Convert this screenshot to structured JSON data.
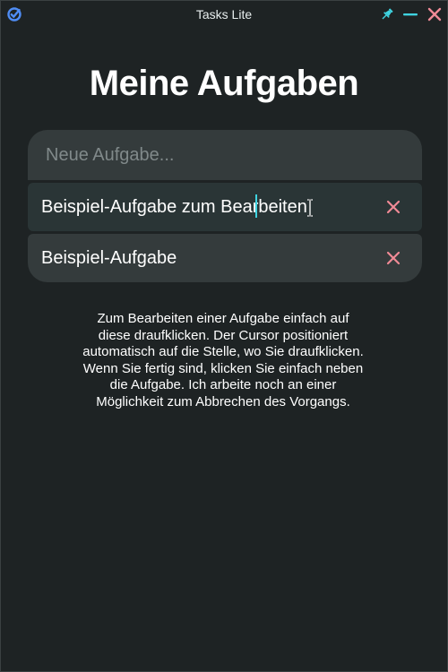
{
  "window": {
    "title": "Tasks Lite",
    "icons": [
      "check-circle-icon",
      "pin-icon",
      "minimize-icon",
      "close-icon"
    ]
  },
  "colors": {
    "accent": "#3fd3e0",
    "delete": "#f08a96",
    "close": "#f08a96",
    "background": "#1e2324",
    "card": "#343b3c"
  },
  "main": {
    "heading": "Meine Aufgaben",
    "new_task": {
      "placeholder": "Neue Aufgabe...",
      "value": ""
    },
    "tasks": [
      {
        "label": "Beispiel-Aufgabe zum Bearbeiten",
        "editing": true,
        "delete_icon": "x-icon"
      },
      {
        "label": "Beispiel-Aufgabe",
        "editing": false,
        "delete_icon": "x-icon"
      }
    ],
    "help_text": "Zum Bearbeiten einer Aufgabe einfach auf diese draufklicken. Der Cursor positioniert automatisch auf die Stelle, wo Sie draufklicken. Wenn Sie fertig sind, klicken Sie einfach neben die Aufgabe. Ich arbeite noch an einer Möglichkeit zum Abbrechen des Vorgangs."
  }
}
